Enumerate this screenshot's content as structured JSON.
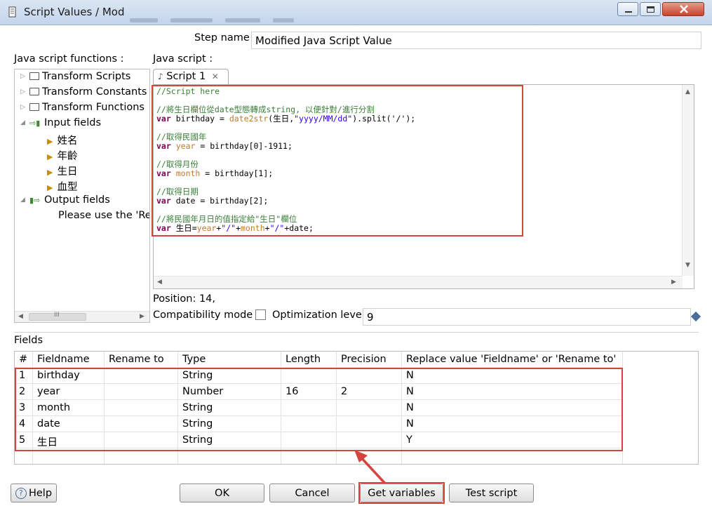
{
  "window": {
    "title": "Script Values / Mod",
    "controls": [
      "minimize",
      "maximize",
      "close"
    ]
  },
  "step_name": {
    "label": "Step name",
    "value": "Modified Java Script Value"
  },
  "functions_panel": {
    "label": "Java script functions :",
    "tree": [
      {
        "label": "Transform Scripts",
        "icon": "folder-icon"
      },
      {
        "label": "Transform Constants",
        "icon": "folder-icon"
      },
      {
        "label": "Transform Functions",
        "icon": "folder-icon"
      },
      {
        "label": "Input fields",
        "icon": "input-fields-icon",
        "children": [
          "姓名",
          "年齡",
          "生日",
          "血型"
        ]
      },
      {
        "label": "Output fields",
        "icon": "output-fields-icon",
        "children": [
          "Please use the 'Rep"
        ]
      }
    ]
  },
  "script_panel": {
    "label": "Java script :",
    "tab_label": "Script 1",
    "code_lines": [
      [
        {
          "t": "//Script here",
          "c": "cmt"
        }
      ],
      [],
      [
        {
          "t": "//將生日欄位從date型態轉成string, 以便針對/進行分割",
          "c": "cmt"
        }
      ],
      [
        {
          "t": "var",
          "c": "kw"
        },
        {
          "t": " birthday = ",
          "c": ""
        },
        {
          "t": "date2str",
          "c": "ident"
        },
        {
          "t": "(生日,",
          "c": ""
        },
        {
          "t": "\"yyyy/MM/dd\"",
          "c": "str"
        },
        {
          "t": ").split('/');",
          "c": ""
        }
      ],
      [],
      [
        {
          "t": "//取得民國年",
          "c": "cmt"
        }
      ],
      [
        {
          "t": "var",
          "c": "kw"
        },
        {
          "t": " ",
          "c": ""
        },
        {
          "t": "year",
          "c": "ident"
        },
        {
          "t": " = birthday[0]-1911;",
          "c": ""
        }
      ],
      [],
      [
        {
          "t": "//取得月份",
          "c": "cmt"
        }
      ],
      [
        {
          "t": "var",
          "c": "kw"
        },
        {
          "t": " ",
          "c": ""
        },
        {
          "t": "month",
          "c": "ident"
        },
        {
          "t": " = birthday[1];",
          "c": ""
        }
      ],
      [],
      [
        {
          "t": "//取得日期",
          "c": "cmt"
        }
      ],
      [
        {
          "t": "var",
          "c": "kw"
        },
        {
          "t": " date = birthday[2];",
          "c": ""
        }
      ],
      [],
      [
        {
          "t": "//將民國年月日的值指定給\"生日\"欄位",
          "c": "cmt"
        }
      ],
      [
        {
          "t": "var",
          "c": "kw"
        },
        {
          "t": " 生日=",
          "c": ""
        },
        {
          "t": "year",
          "c": "ident"
        },
        {
          "t": "+",
          "c": ""
        },
        {
          "t": "\"/\"",
          "c": "str"
        },
        {
          "t": "+",
          "c": ""
        },
        {
          "t": "month",
          "c": "ident"
        },
        {
          "t": "+",
          "c": ""
        },
        {
          "t": "\"/\"",
          "c": "str"
        },
        {
          "t": "+date;",
          "c": ""
        }
      ]
    ],
    "position": "Position: 14, 0",
    "compatibility_label": "Compatibility mode?",
    "optimization_label": "Optimization level",
    "optimization_value": "9"
  },
  "fields": {
    "label": "Fields",
    "columns": [
      "#",
      "Fieldname",
      "Rename to",
      "Type",
      "Length",
      "Precision",
      "Replace value 'Fieldname' or 'Rename to'"
    ],
    "rows": [
      [
        "1",
        "birthday",
        "",
        "String",
        "",
        "",
        "N"
      ],
      [
        "2",
        "year",
        "",
        "Number",
        "16",
        "2",
        "N"
      ],
      [
        "3",
        "month",
        "",
        "String",
        "",
        "",
        "N"
      ],
      [
        "4",
        "date",
        "",
        "String",
        "",
        "",
        "N"
      ],
      [
        "5",
        "生日",
        "",
        "String",
        "",
        "",
        "Y"
      ]
    ]
  },
  "buttons": {
    "help": "Help",
    "ok": "OK",
    "cancel": "Cancel",
    "get_variables": "Get variables",
    "test_script": "Test script"
  },
  "colors": {
    "highlight_box": "#d4453e",
    "arrow": "#d4453e",
    "comment": "#3a7f3a",
    "keyword": "#7f0055",
    "identifier": "#c07a2e",
    "string": "#2a00ff"
  }
}
